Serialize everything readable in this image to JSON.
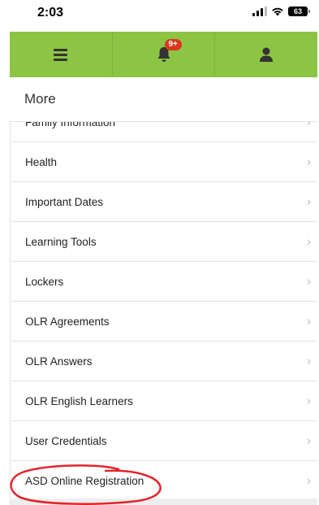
{
  "status_bar": {
    "time": "2:03",
    "battery": "63"
  },
  "navbar": {
    "notification_badge": "9+",
    "accent_color": "#8cc443"
  },
  "page": {
    "title": "More"
  },
  "menu": {
    "items": [
      {
        "label": "Family Information"
      },
      {
        "label": "Health"
      },
      {
        "label": "Important Dates"
      },
      {
        "label": "Learning Tools"
      },
      {
        "label": "Lockers"
      },
      {
        "label": "OLR Agreements"
      },
      {
        "label": "OLR Answers"
      },
      {
        "label": "OLR English Learners"
      },
      {
        "label": "User Credentials"
      },
      {
        "label": "ASD Online Registration"
      }
    ]
  },
  "annotation": {
    "color": "#e3242b"
  }
}
